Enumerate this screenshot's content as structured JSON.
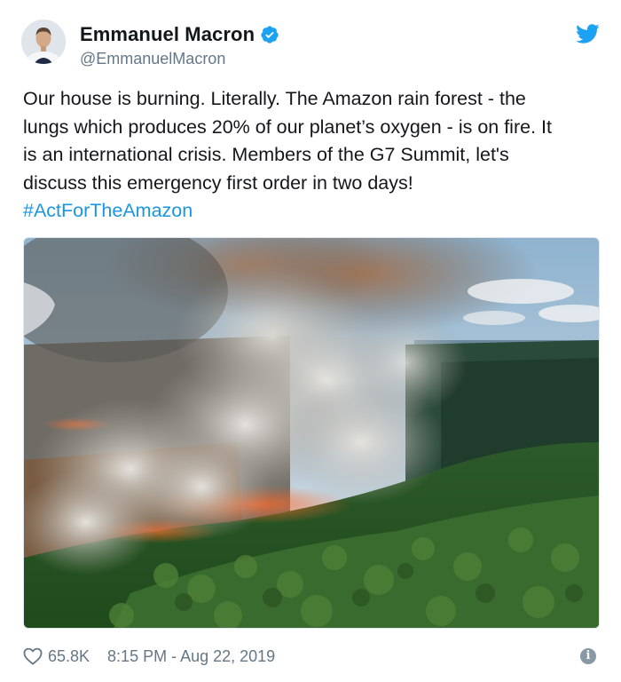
{
  "tweet": {
    "author": {
      "display_name": "Emmanuel Macron",
      "handle": "@EmmanuelMacron",
      "verified": true,
      "avatar_icon": "avatar-photo"
    },
    "text": "Our house is burning. Literally. The Amazon rain forest - the\nlungs which produces 20% of our planet’s oxygen - is on fire. It\nis an international crisis. Members of the G7 Summit, let's\ndiscuss this emergency first order in two days!",
    "hashtag": "#ActForTheAmazon",
    "media": {
      "icon": "wildfire-photo",
      "subject": "Amazon rainforest fire with smoke plumes"
    },
    "likes": "65.8K",
    "timestamp": "8:15 PM - Aug 22, 2019"
  },
  "colors": {
    "link": "#1b95e0",
    "twitter_blue": "#1da1f2",
    "secondary_text": "#657786",
    "primary_text": "#14171a"
  },
  "icons": {
    "logo": "twitter-bird-icon",
    "verified": "verified-badge-icon",
    "like": "heart-icon",
    "info": "info-icon"
  }
}
